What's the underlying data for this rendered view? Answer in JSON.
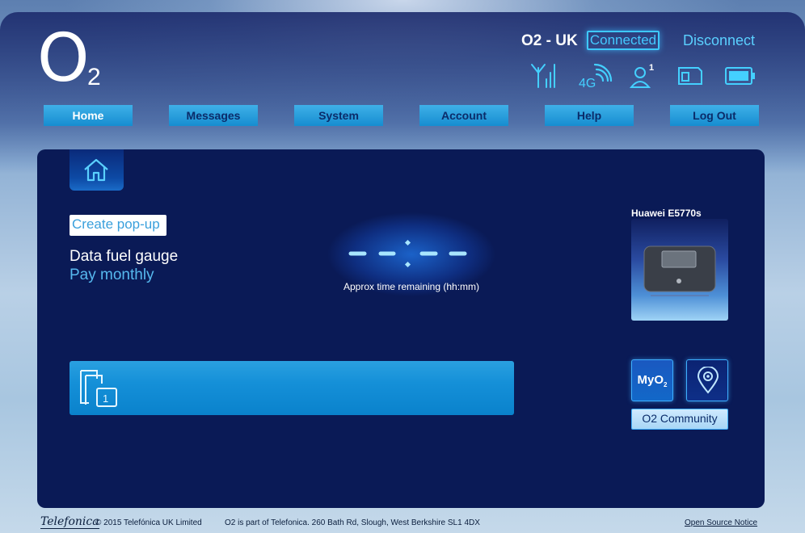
{
  "header": {
    "logo_letter": "O",
    "logo_subscript": "2",
    "network_name": "O2 - UK",
    "connection_status": "Connected",
    "disconnect_label": "Disconnect",
    "status_icons": [
      "signal-antenna-icon",
      "4g-signal-icon",
      "user-count-icon",
      "sim-card-icon",
      "battery-icon"
    ],
    "network_type": "4G",
    "user_count": "1",
    "accent_color": "#3ec8ff"
  },
  "nav": {
    "tabs": [
      {
        "label": "Home",
        "active": true
      },
      {
        "label": "Messages"
      },
      {
        "label": "System"
      },
      {
        "label": "Account"
      },
      {
        "label": "Help"
      },
      {
        "label": "Log Out"
      }
    ]
  },
  "main": {
    "popup_label": "Create pop-up",
    "gauge_title": "Data fuel gauge",
    "gauge_plan": "Pay monthly",
    "timer_label": "Approx time remaining (hh:mm)",
    "device_name": "Huawei E5770s",
    "sms_count": "1",
    "myo2_label": "MyO",
    "myo2_sub": "2",
    "community_label": "O2 Community"
  },
  "footer": {
    "brand": "Telefonica",
    "copyright": "© 2015 Telefónica UK Limited",
    "address": "O2 is part of Telefonica. 260 Bath Rd, Slough, West Berkshire SL1 4DX",
    "open_source": "Open Source Notice"
  }
}
